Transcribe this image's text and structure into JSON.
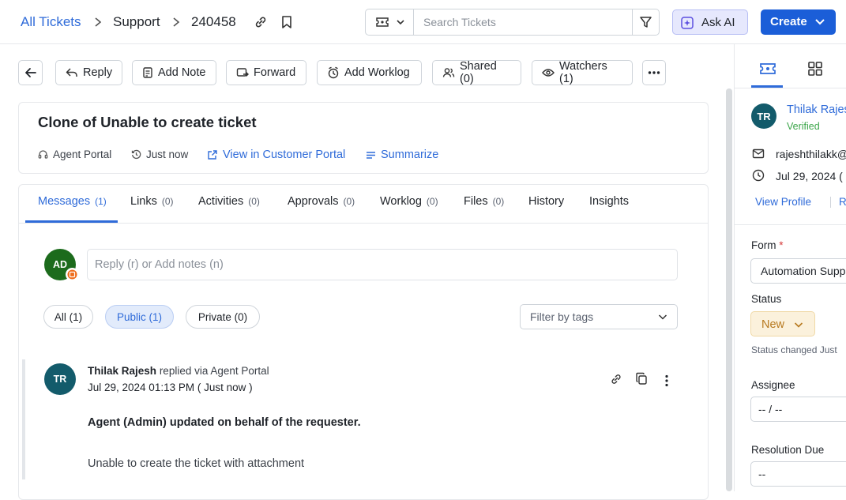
{
  "breadcrumb": {
    "root": "All Tickets",
    "section": "Support",
    "ticket_id": "240458"
  },
  "search": {
    "placeholder": "Search Tickets"
  },
  "ask_ai_label": "Ask AI",
  "create_label": "Create",
  "toolbar": {
    "reply": "Reply",
    "add_note": "Add Note",
    "forward": "Forward",
    "add_worklog": "Add Worklog",
    "shared": "Shared (0)",
    "watchers": "Watchers (1)"
  },
  "ticket": {
    "title": "Clone of Unable to create ticket",
    "source": "Agent Portal",
    "time": "Just now",
    "customer_portal_link": "View in Customer Portal",
    "summarize": "Summarize"
  },
  "tabs": [
    {
      "label": "Messages",
      "count": "(1)"
    },
    {
      "label": "Links",
      "count": "(0)"
    },
    {
      "label": "Activities",
      "count": "(0)"
    },
    {
      "label": "Approvals",
      "count": "(0)"
    },
    {
      "label": "Worklog",
      "count": "(0)"
    },
    {
      "label": "Files",
      "count": "(0)"
    },
    {
      "label": "History",
      "count": ""
    },
    {
      "label": "Insights",
      "count": ""
    }
  ],
  "composer": {
    "avatar_initials": "AD",
    "placeholder": "Reply (r) or Add notes (n)"
  },
  "filters": {
    "all": "All (1)",
    "public": "Public (1)",
    "private": "Private (0)",
    "tags_placeholder": "Filter by tags"
  },
  "message": {
    "avatar_initials": "TR",
    "author": "Thilak Rajesh",
    "action": "replied via Agent Portal",
    "timestamp": "Jul 29, 2024 01:13 PM ( Just now )",
    "body_bold": "Agent (Admin) updated on behalf of the requester.",
    "body": "Unable to create the ticket with attachment"
  },
  "requester": {
    "avatar_initials": "TR",
    "name": "Thilak Rajes",
    "verified": "Verified",
    "email": "rajeshthilakk@",
    "date": "Jul 29, 2024 (",
    "view_profile": "View Profile",
    "other_link": "R"
  },
  "fields": {
    "form_label": "Form",
    "required_mark": "*",
    "form_value": "Automation Supp",
    "status_label": "Status",
    "status_value": "New",
    "status_changed": "Status changed Just",
    "assignee_label": "Assignee",
    "assignee_value": "-- / --",
    "resolution_label": "Resolution Due",
    "resolution_value": "--"
  },
  "colors": {
    "accent": "#2f6bd9",
    "primary_button": "#1b5ed8",
    "avatar_green": "#1c6b1c",
    "avatar_teal": "#135b6b",
    "status_bg": "#fbf1dc",
    "status_text": "#b7791f"
  }
}
